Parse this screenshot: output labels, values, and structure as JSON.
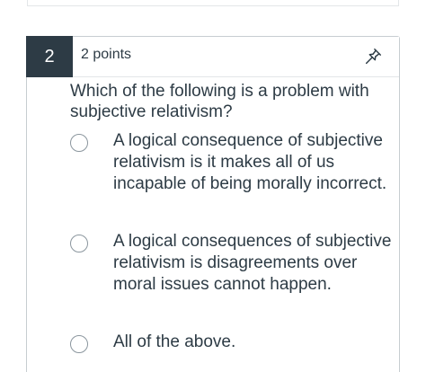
{
  "question": {
    "number": "2",
    "points": "2 points",
    "text": "Which of the following is a problem with subjective relativism?",
    "answers": [
      {
        "text": "A logical consequence of subjective relativism is it makes all of us incapable of being morally incorrect."
      },
      {
        "text": "A logical consequences of subjective relativism is disagreements over moral issues cannot happen."
      },
      {
        "text": "All of the above."
      }
    ]
  },
  "icons": {
    "pin": "pin-icon",
    "radio": "radio-icon"
  },
  "colors": {
    "number_badge_bg": "#2d3b45",
    "text": "#2d3b45",
    "border": "#c7cdd1"
  }
}
